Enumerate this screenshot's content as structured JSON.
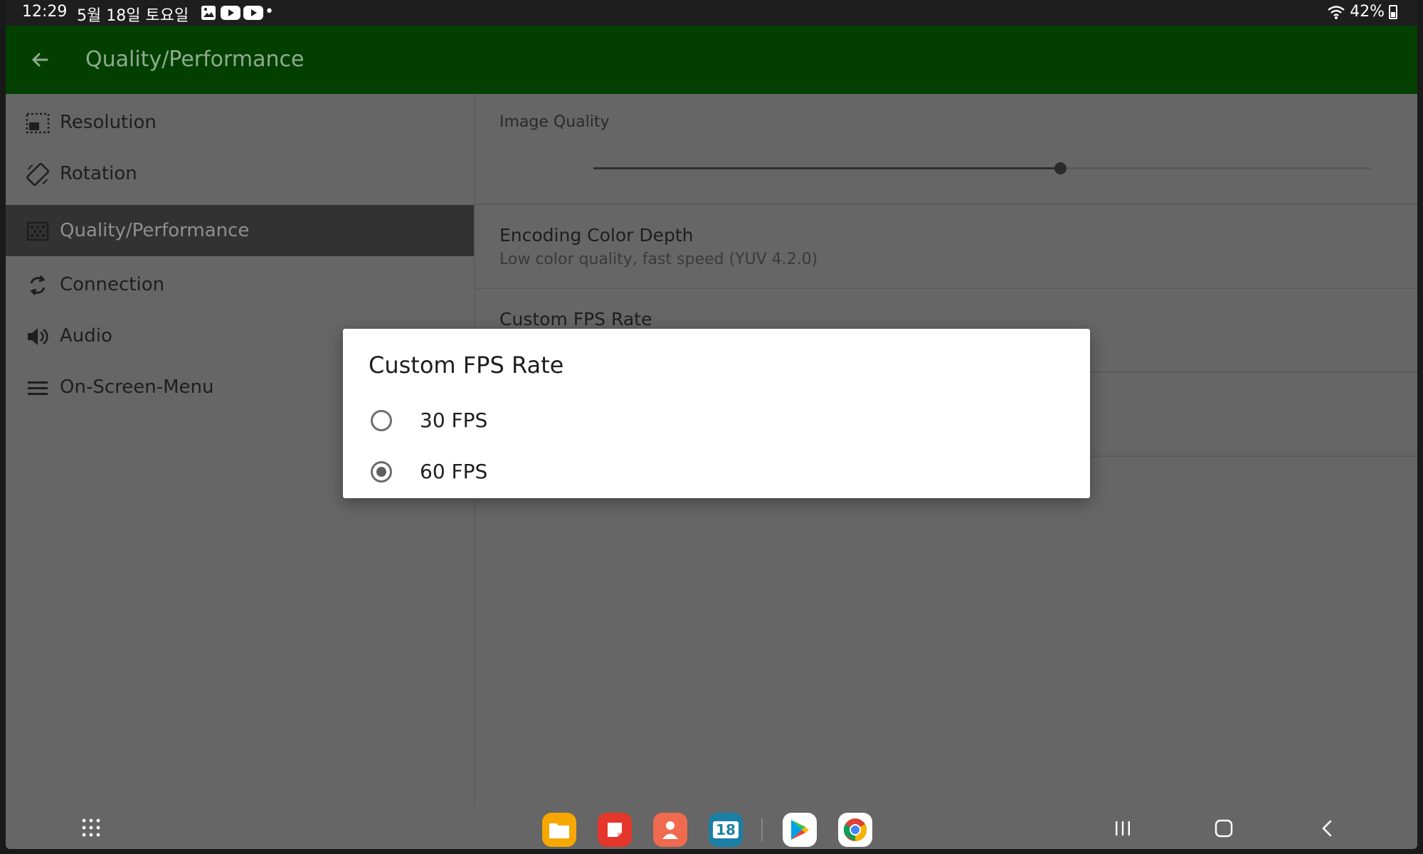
{
  "status_bar": {
    "time": "12:29",
    "date": "5월 18일 토요일",
    "dot": "•",
    "battery": "42%"
  },
  "app_bar": {
    "title": "Quality/Performance"
  },
  "sidebar": {
    "items": [
      {
        "label": "Resolution",
        "icon": "resolution-icon",
        "active": false
      },
      {
        "label": "Rotation",
        "icon": "rotation-icon",
        "active": false
      },
      {
        "label": "Quality/Performance",
        "icon": "quality-icon",
        "active": true
      },
      {
        "label": "Connection",
        "icon": "connection-icon",
        "active": false
      },
      {
        "label": "Audio",
        "icon": "audio-icon",
        "active": false
      },
      {
        "label": "On-Screen-Menu",
        "icon": "menu-icon",
        "active": false
      }
    ]
  },
  "settings": {
    "image_quality": {
      "title": "Image Quality",
      "value_fraction": 0.6
    },
    "encoding_color_depth": {
      "title": "Encoding Color Depth",
      "summary": "Low color quality, fast speed (YUV 4.2.0)"
    },
    "custom_fps": {
      "title": "Custom FPS Rate"
    }
  },
  "dialog": {
    "title": "Custom FPS Rate",
    "options": [
      {
        "label": "30 FPS",
        "selected": false
      },
      {
        "label": "60 FPS",
        "selected": true
      }
    ]
  },
  "dock": {
    "apps": [
      {
        "name": "files",
        "color": "#f6a800"
      },
      {
        "name": "notes",
        "color": "#e5362c"
      },
      {
        "name": "contacts",
        "color": "#f06a50"
      },
      {
        "name": "calendar",
        "color": "#1a7fa4",
        "label": "18"
      },
      {
        "name": "play-store",
        "color": "#ffffff"
      },
      {
        "name": "chrome",
        "color": "#ffffff"
      }
    ]
  }
}
